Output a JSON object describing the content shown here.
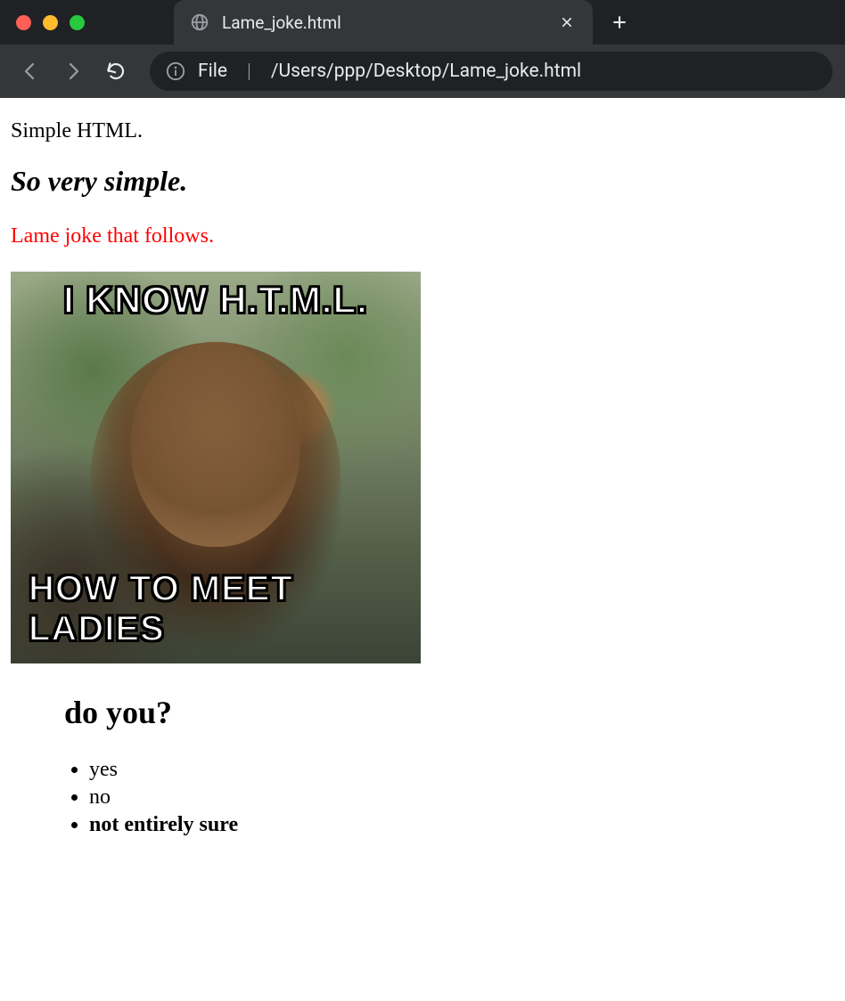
{
  "browser": {
    "tab_title": "Lame_joke.html",
    "url_scheme": "File",
    "url_path": "/Users/ppp/Desktop/Lame_joke.html"
  },
  "content": {
    "line1": "Simple HTML.",
    "line2": "So very simple.",
    "line3": "Lame joke that follows.",
    "meme_top": "I KNOW H.T.M.L.",
    "meme_bottom": "HOW TO MEET LADIES",
    "heading": "do you?",
    "list": {
      "item1": "yes",
      "item2": "no",
      "item3": "not entirely sure"
    }
  }
}
